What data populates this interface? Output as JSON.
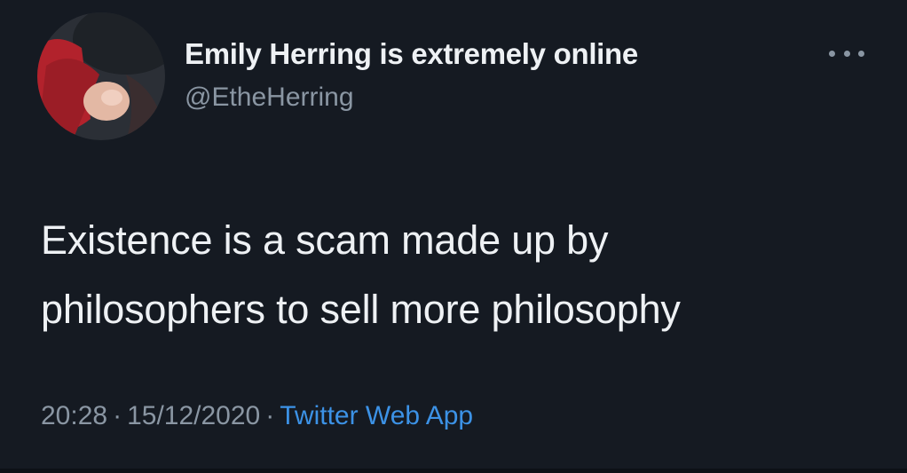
{
  "tweet": {
    "author": {
      "display_name": "Emily Herring is extremely online",
      "handle": "@EtheHerring",
      "avatar_icon": "profile-photo"
    },
    "more_icon": "more-horizontal-icon",
    "text_lines": [
      "Existence is a scam made up by",
      "philosophers to sell more philosophy"
    ],
    "time": "20:28",
    "date": "15/12/2020",
    "separator": "·",
    "source": "Twitter Web App"
  },
  "colors": {
    "background": "#151a22",
    "primary_text": "#eef1f4",
    "secondary_text": "#8a96a3",
    "link": "#3c92e6"
  }
}
